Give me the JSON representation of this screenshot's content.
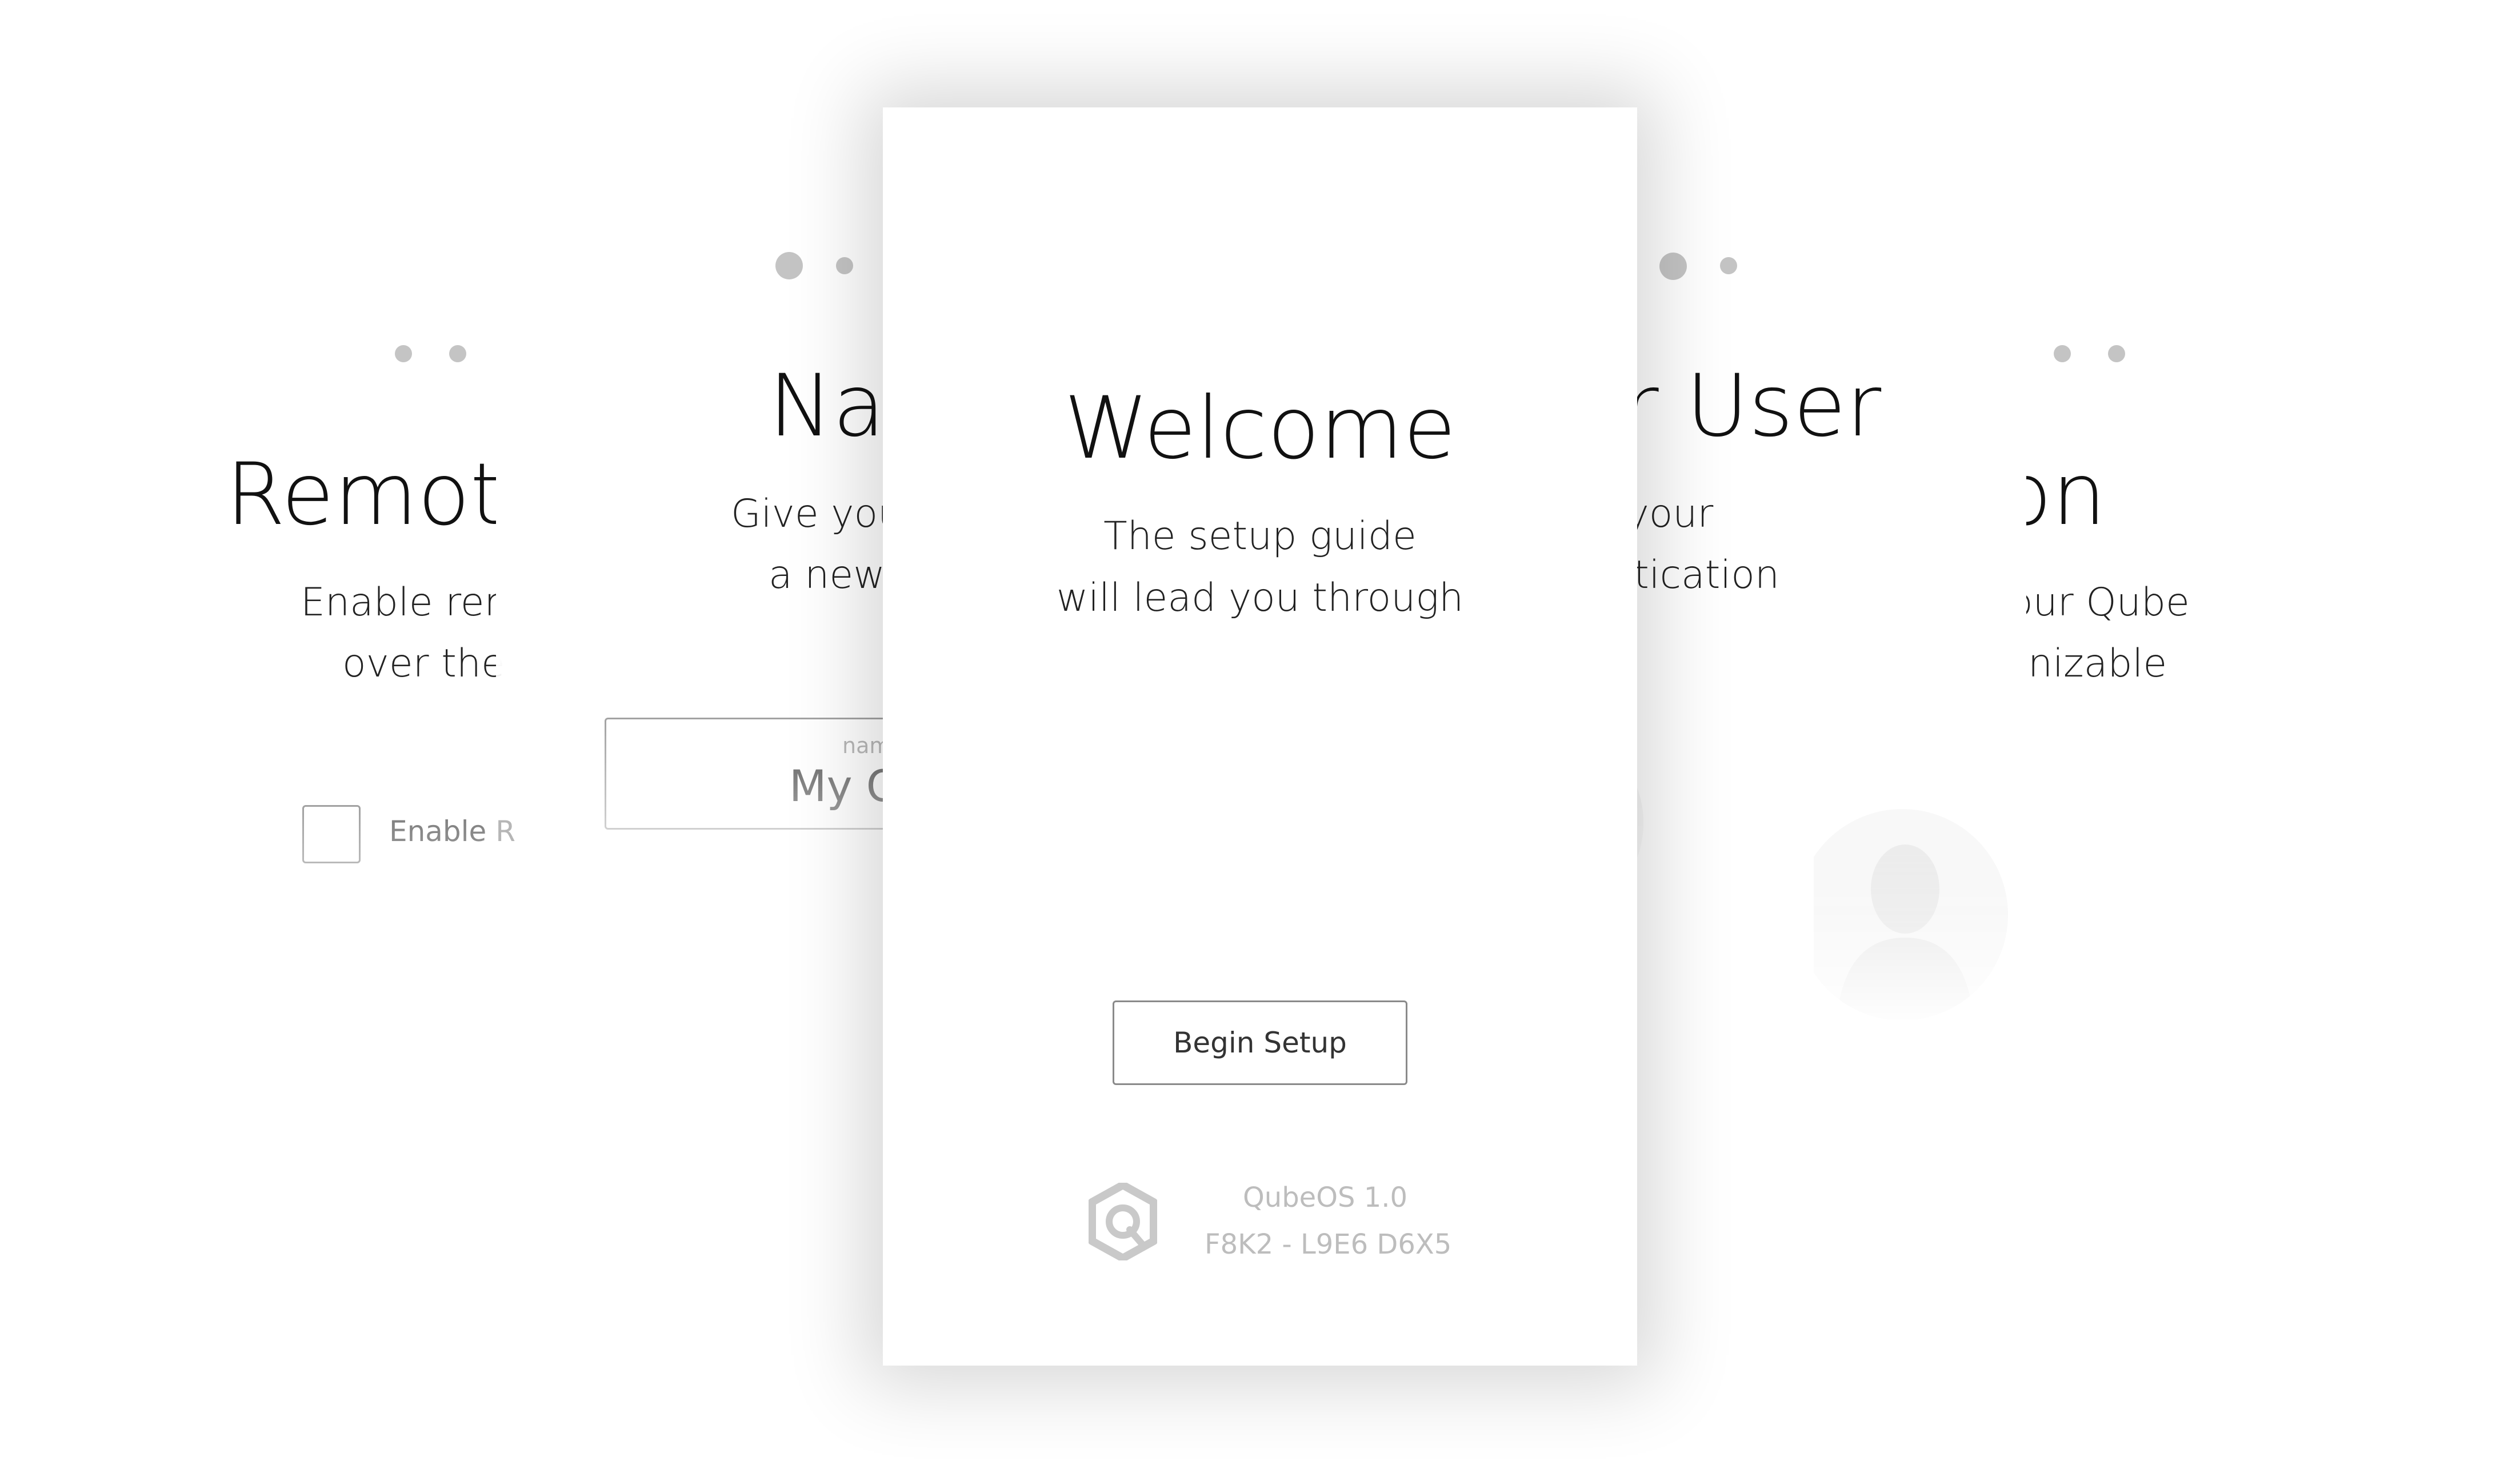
{
  "cards": {
    "remote": {
      "title": "Remote",
      "line1": "Enable remo",
      "line2": "over the",
      "checkbox_label": "Enable R"
    },
    "name": {
      "title": "Nar",
      "line1": "Give you",
      "line2": "a new",
      "field_label": "nam",
      "field_value": "My Q"
    },
    "welcome": {
      "title": "Welcome",
      "line1": "The setup guide",
      "line2": "will lead you through",
      "button_label": "Begin Setup",
      "os_name": "QubeOS 1.0",
      "serial": "F8K2 - L9E6 D6X5"
    },
    "user": {
      "title": "r User",
      "line1": "e your",
      "line2": "ntication"
    },
    "icon": {
      "title": "on",
      "line1": "our Qube",
      "line2": "nizable"
    }
  },
  "icons": {
    "logo": "qube-logo-icon",
    "avatar": "person-silhouette-icon"
  },
  "colors": {
    "page_dots": "#c4c4c4",
    "muted_text": "#bdbdbd",
    "border": "#8a8a8a"
  }
}
